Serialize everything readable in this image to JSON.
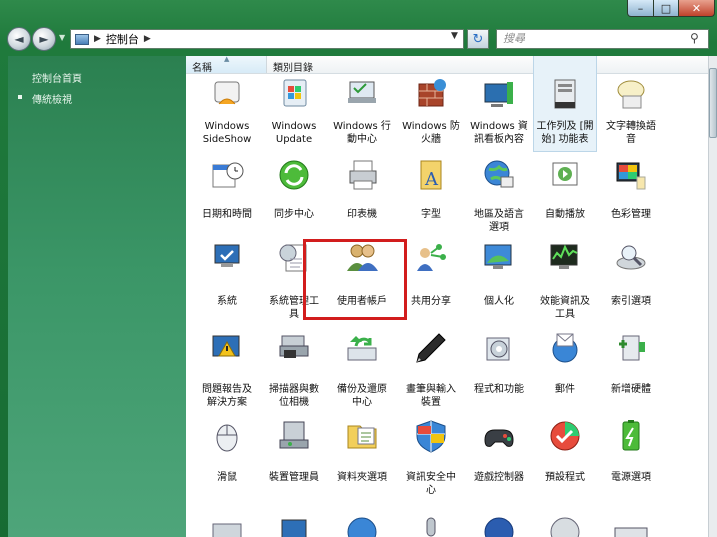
{
  "window": {
    "caption_min": "–",
    "caption_max": "□",
    "caption_close": "✕"
  },
  "nav": {
    "back_icon": "◄",
    "fwd_icon": "►",
    "address": "控制台",
    "address_sep": "▶",
    "drop": "▼",
    "refresh_icon": "↻",
    "search_placeholder": "搜尋",
    "search_icon": "⚲"
  },
  "sidebar": {
    "home": "控制台首頁",
    "classic": "傳統檢視"
  },
  "columns": {
    "name": "名稱",
    "category": "類別目錄",
    "sort_arrow": "▲"
  },
  "items": [
    {
      "label": "Windows\nSideShow",
      "icon": "sideshow-icon"
    },
    {
      "label": "Windows\nUpdate",
      "icon": "windows-update-icon"
    },
    {
      "label": "Windows 行\n動中心",
      "icon": "mobility-center-icon"
    },
    {
      "label": "Windows 防\n火牆",
      "icon": "firewall-icon"
    },
    {
      "label": "Windows 資\n訊看板內容",
      "icon": "sidebar-icon"
    },
    {
      "label": "工作列及 [開\n始] 功能表",
      "icon": "taskbar-icon"
    },
    {
      "label": "文字轉換語\n音",
      "icon": "text-to-speech-icon"
    },
    {
      "label": "日期和時間",
      "icon": "date-time-icon"
    },
    {
      "label": "同步中心",
      "icon": "sync-center-icon"
    },
    {
      "label": "印表機",
      "icon": "printer-icon"
    },
    {
      "label": "字型",
      "icon": "fonts-icon"
    },
    {
      "label": "地區及語言\n選項",
      "icon": "region-language-icon"
    },
    {
      "label": "自動播放",
      "icon": "autoplay-icon"
    },
    {
      "label": "色彩管理",
      "icon": "color-management-icon"
    },
    {
      "label": "系統",
      "icon": "system-icon"
    },
    {
      "label": "系統管理工\n具",
      "icon": "admin-tools-icon"
    },
    {
      "label": "使用者帳戶",
      "icon": "user-accounts-icon"
    },
    {
      "label": "共用分享",
      "icon": "sharing-icon"
    },
    {
      "label": "個人化",
      "icon": "personalization-icon"
    },
    {
      "label": "效能資訊及\n工具",
      "icon": "performance-icon"
    },
    {
      "label": "索引選項",
      "icon": "indexing-icon"
    },
    {
      "label": "問題報告及\n解決方案",
      "icon": "problem-reports-icon"
    },
    {
      "label": "掃描器與數\n位相機",
      "icon": "scanner-icon"
    },
    {
      "label": "備份及還原\n中心",
      "icon": "backup-icon"
    },
    {
      "label": "畫筆與輸入\n裝置",
      "icon": "pen-input-icon"
    },
    {
      "label": "程式和功能",
      "icon": "programs-icon"
    },
    {
      "label": "郵件",
      "icon": "mail-icon"
    },
    {
      "label": "新增硬體",
      "icon": "add-hardware-icon"
    },
    {
      "label": "滑鼠",
      "icon": "mouse-icon"
    },
    {
      "label": "裝置管理員",
      "icon": "device-manager-icon"
    },
    {
      "label": "資料夾選項",
      "icon": "folder-options-icon"
    },
    {
      "label": "資訊安全中\n心",
      "icon": "security-center-icon"
    },
    {
      "label": "遊戲控制器",
      "icon": "game-controller-icon"
    },
    {
      "label": "預設程式",
      "icon": "default-programs-icon"
    },
    {
      "label": "電源選項",
      "icon": "power-options-icon"
    }
  ],
  "partial_row_icons": [
    "phone-modem-icon",
    "network-icon",
    "internet-icon",
    "speech-icon",
    "bluetooth-icon",
    "sound-icon",
    "keyboard-icon"
  ],
  "selected_item": "taskbar-icon",
  "highlighted_item": "user-accounts-icon",
  "colors": {
    "highlight": "#d21d1d",
    "accent": "#1f7a3c"
  }
}
